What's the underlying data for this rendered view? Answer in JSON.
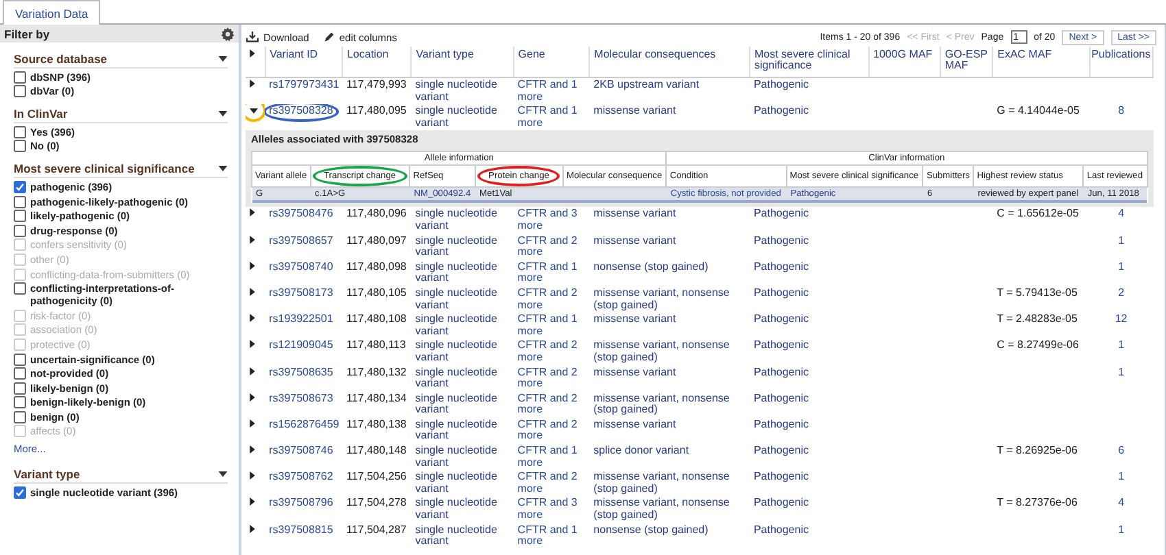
{
  "tabs": [
    {
      "label": "Variation Data",
      "selected": true
    }
  ],
  "sidebar": {
    "title": "Filter by",
    "sections": [
      {
        "title": "Source database",
        "items": [
          {
            "label": "dbSNP (396)",
            "checked": false,
            "disabled": false
          },
          {
            "label": "dbVar (0)",
            "checked": false,
            "disabled": false
          }
        ]
      },
      {
        "title": "In ClinVar",
        "items": [
          {
            "label": "Yes (396)",
            "checked": false,
            "disabled": false
          },
          {
            "label": "No (0)",
            "checked": false,
            "disabled": false
          }
        ]
      },
      {
        "title": "Most severe clinical significance",
        "items": [
          {
            "label": "pathogenic (396)",
            "checked": true,
            "disabled": false
          },
          {
            "label": "pathogenic-likely-pathogenic (0)",
            "checked": false,
            "disabled": false
          },
          {
            "label": "likely-pathogenic (0)",
            "checked": false,
            "disabled": false
          },
          {
            "label": "drug-response (0)",
            "checked": false,
            "disabled": false
          },
          {
            "label": "confers sensitivity (0)",
            "checked": false,
            "disabled": true
          },
          {
            "label": "other (0)",
            "checked": false,
            "disabled": true
          },
          {
            "label": "conflicting-data-from-submitters (0)",
            "checked": false,
            "disabled": true
          },
          {
            "label": "conflicting-interpretations-of-pathogenicity (0)",
            "checked": false,
            "disabled": false
          },
          {
            "label": "risk-factor (0)",
            "checked": false,
            "disabled": true
          },
          {
            "label": "association (0)",
            "checked": false,
            "disabled": true
          },
          {
            "label": "protective (0)",
            "checked": false,
            "disabled": true
          },
          {
            "label": "uncertain-significance (0)",
            "checked": false,
            "disabled": false
          },
          {
            "label": "not-provided (0)",
            "checked": false,
            "disabled": false
          },
          {
            "label": "likely-benign (0)",
            "checked": false,
            "disabled": false
          },
          {
            "label": "benign-likely-benign (0)",
            "checked": false,
            "disabled": false
          },
          {
            "label": "benign (0)",
            "checked": false,
            "disabled": false
          },
          {
            "label": "affects (0)",
            "checked": false,
            "disabled": true
          }
        ],
        "more": "More..."
      },
      {
        "title": "Variant type",
        "items": [
          {
            "label": "single nucleotide variant (396)",
            "checked": true,
            "disabled": false
          }
        ]
      }
    ]
  },
  "toolbar": {
    "download": "Download",
    "edit_columns": "edit columns"
  },
  "pagination": {
    "items": "Items 1 - 20 of 396",
    "first": "<< First",
    "prev": "< Prev",
    "page_label": "Page",
    "page": "1",
    "of": "of 20",
    "next": "Next >",
    "last": "Last >>"
  },
  "table": {
    "columns": [
      "Variant ID",
      "Location",
      "Variant type",
      "Gene",
      "Molecular consequences",
      "Most severe clinical significance",
      "1000G MAF",
      "GO-ESP MAF",
      "ExAC MAF",
      "Publications"
    ],
    "rows": [
      {
        "id": "rs1797973431",
        "location": "117,479,993",
        "type": "single nucleotide variant",
        "gene": "CFTR and 1 more",
        "consequence": "2KB upstream variant",
        "significance": "Pathogenic",
        "expanded": false
      },
      {
        "id": "rs397508328",
        "location": "117,480,095",
        "type": "single nucleotide variant",
        "gene": "CFTR and 1 more",
        "consequence": "missense variant",
        "significance": "Pathogenic",
        "exac": "G = 4.14044e-05",
        "publications": "8",
        "expanded": true,
        "toggle_highlight": {
          "color": "#f5b800"
        },
        "id_highlight": {
          "color": "#3a62c4"
        },
        "alleles": {
          "title": "Alleles associated with 397508328",
          "group_1": "Allele information",
          "group_2": "ClinVar information",
          "columns": [
            {
              "label": "Variant allele"
            },
            {
              "label": "Transcript change",
              "highlight": {
                "color": "#1aa54a"
              }
            },
            {
              "label": "RefSeq"
            },
            {
              "label": "Protein change",
              "highlight": {
                "color": "#e02020"
              }
            },
            {
              "label": "Molecular consequence"
            },
            {
              "label": "Condition"
            },
            {
              "label": "Most severe clinical significance"
            },
            {
              "label": "Submitters"
            },
            {
              "label": "Highest review status"
            },
            {
              "label": "Last reviewed"
            }
          ],
          "rows": [
            {
              "allele": "G",
              "transcript": "c.1A>G",
              "refseq": "NM_000492.4",
              "protein": "Met1Val",
              "condition": "Cystic fibrosis, not provided",
              "significance": "Pathogenic",
              "submitters": "6",
              "review": "reviewed by expert panel",
              "last_reviewed": "Jun, 11 2018"
            }
          ]
        }
      },
      {
        "id": "rs397508476",
        "location": "117,480,096",
        "type": "single nucleotide variant",
        "gene": "CFTR and 3 more",
        "consequence": "missense variant",
        "significance": "Pathogenic",
        "exac": "C = 1.65612e-05",
        "publications": "4",
        "expanded": false
      },
      {
        "id": "rs397508657",
        "location": "117,480,097",
        "type": "single nucleotide variant",
        "gene": "CFTR and 2 more",
        "consequence": "missense variant",
        "significance": "Pathogenic",
        "publications": "1",
        "expanded": false
      },
      {
        "id": "rs397508740",
        "location": "117,480,098",
        "type": "single nucleotide variant",
        "gene": "CFTR and 1 more",
        "consequence": "nonsense (stop gained)",
        "significance": "Pathogenic",
        "publications": "1",
        "expanded": false
      },
      {
        "id": "rs397508173",
        "location": "117,480,105",
        "type": "single nucleotide variant",
        "gene": "CFTR and 2 more",
        "consequence": "missense variant, nonsense (stop gained)",
        "significance": "Pathogenic",
        "exac": "T = 5.79413e-05",
        "publications": "2",
        "expanded": false
      },
      {
        "id": "rs193922501",
        "location": "117,480,108",
        "type": "single nucleotide variant",
        "gene": "CFTR and 1 more",
        "consequence": "missense variant",
        "significance": "Pathogenic",
        "exac": "T = 2.48283e-05",
        "publications": "12",
        "expanded": false
      },
      {
        "id": "rs121909045",
        "location": "117,480,113",
        "type": "single nucleotide variant",
        "gene": "CFTR and 2 more",
        "consequence": "missense variant, nonsense (stop gained)",
        "significance": "Pathogenic",
        "exac": "C = 8.27499e-06",
        "publications": "1",
        "expanded": false
      },
      {
        "id": "rs397508635",
        "location": "117,480,132",
        "type": "single nucleotide variant",
        "gene": "CFTR and 2 more",
        "consequence": "missense variant",
        "significance": "Pathogenic",
        "publications": "1",
        "expanded": false
      },
      {
        "id": "rs397508673",
        "location": "117,480,134",
        "type": "single nucleotide variant",
        "gene": "CFTR and 2 more",
        "consequence": "missense variant, nonsense (stop gained)",
        "significance": "Pathogenic",
        "expanded": false
      },
      {
        "id": "rs1562876459",
        "location": "117,480,138",
        "type": "single nucleotide variant",
        "gene": "CFTR and 2 more",
        "consequence": "missense variant",
        "significance": "Pathogenic",
        "expanded": false
      },
      {
        "id": "rs397508746",
        "location": "117,480,148",
        "type": "single nucleotide variant",
        "gene": "CFTR and 1 more",
        "consequence": "splice donor variant",
        "significance": "Pathogenic",
        "exac": "T = 8.26925e-06",
        "publications": "6",
        "expanded": false
      },
      {
        "id": "rs397508762",
        "location": "117,504,256",
        "type": "single nucleotide variant",
        "gene": "CFTR and 2 more",
        "consequence": "missense variant, nonsense (stop gained)",
        "significance": "Pathogenic",
        "publications": "1",
        "expanded": false
      },
      {
        "id": "rs397508796",
        "location": "117,504,278",
        "type": "single nucleotide variant",
        "gene": "CFTR and 3 more",
        "consequence": "missense variant, nonsense (stop gained)",
        "significance": "Pathogenic",
        "exac": "T = 8.27376e-06",
        "publications": "4",
        "expanded": false
      },
      {
        "id": "rs397508815",
        "location": "117,504,287",
        "type": "single nucleotide variant",
        "gene": "CFTR and 1 more",
        "consequence": "nonsense (stop gained)",
        "significance": "Pathogenic",
        "publications": "1",
        "expanded": false
      }
    ]
  }
}
